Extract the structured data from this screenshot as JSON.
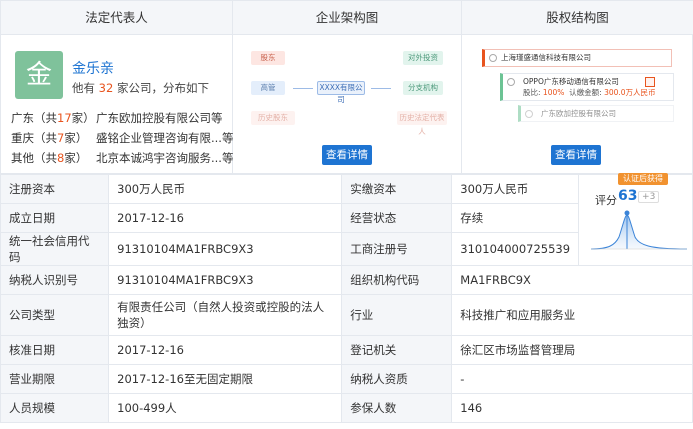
{
  "sections": {
    "legal_rep_title": "法定代表人",
    "org_title": "企业架构图",
    "equity_title": "股权结构图"
  },
  "person": {
    "avatar_char": "金",
    "name": "金乐亲",
    "sub_prefix": "他有",
    "company_count": "32",
    "sub_suffix": "家公司，分布如下",
    "regions": [
      {
        "prefix": "广东（共",
        "count": "17",
        "suffix": "家）",
        "company": "广东欧加控股有限公司等"
      },
      {
        "prefix": "重庆（共",
        "count": "7",
        "suffix": "家）",
        "company": "盛铭企业管理咨询有限...等"
      },
      {
        "prefix": "其他（共",
        "count": "8",
        "suffix": "家）",
        "company": "北京本诚鸿宇咨询服务...等"
      }
    ]
  },
  "org": {
    "shareholder": "股东",
    "executive": "高管",
    "history_shareholder": "历史股东",
    "center": "XXXX有限公司",
    "investment": "对外投资",
    "branch": "分支机构",
    "history_legal": "历史法定代表人",
    "detail_button": "查看详情"
  },
  "equity": {
    "root": "上海瑾盛通信科技有限公司",
    "child_name": "OPPO广东移动通信有限公司",
    "child_ratio_label": "股比:",
    "child_ratio": "100%",
    "child_capital_label": "认缴金额:",
    "child_capital": "300.0万人民币",
    "child2_name": "广东欧加控股有限公司",
    "detail_button": "查看详情"
  },
  "score": {
    "badge": "认证后获得",
    "label": "评分",
    "value": "63",
    "delta": "+3"
  },
  "table": {
    "rows": [
      {
        "l1": "注册资本",
        "v1": "300万人民币",
        "l2": "实缴资本",
        "v2": "300万人民币"
      },
      {
        "l1": "成立日期",
        "v1": "2017-12-16",
        "l2": "经营状态",
        "v2": "存续"
      },
      {
        "l1": "统一社会信用代码",
        "v1": "91310104MA1FRBC9X3",
        "l2": "工商注册号",
        "v2": "310104000725539"
      },
      {
        "l1": "纳税人识别号",
        "v1": "91310104MA1FRBC9X3",
        "l2": "组织机构代码",
        "v2": "MA1FRBC9X"
      },
      {
        "l1": "公司类型",
        "v1": "有限责任公司（自然人投资或控股的法人独资）",
        "l2": "行业",
        "v2": "科技推广和应用服务业"
      },
      {
        "l1": "核准日期",
        "v1": "2017-12-16",
        "l2": "登记机关",
        "v2": "徐汇区市场监督管理局"
      },
      {
        "l1": "营业期限",
        "v1": "2017-12-16至无固定期限",
        "l2": "纳税人资质",
        "v2": "-"
      },
      {
        "l1": "人员规模",
        "v1": "100-499人",
        "l2": "参保人数",
        "v2": "146"
      }
    ]
  }
}
